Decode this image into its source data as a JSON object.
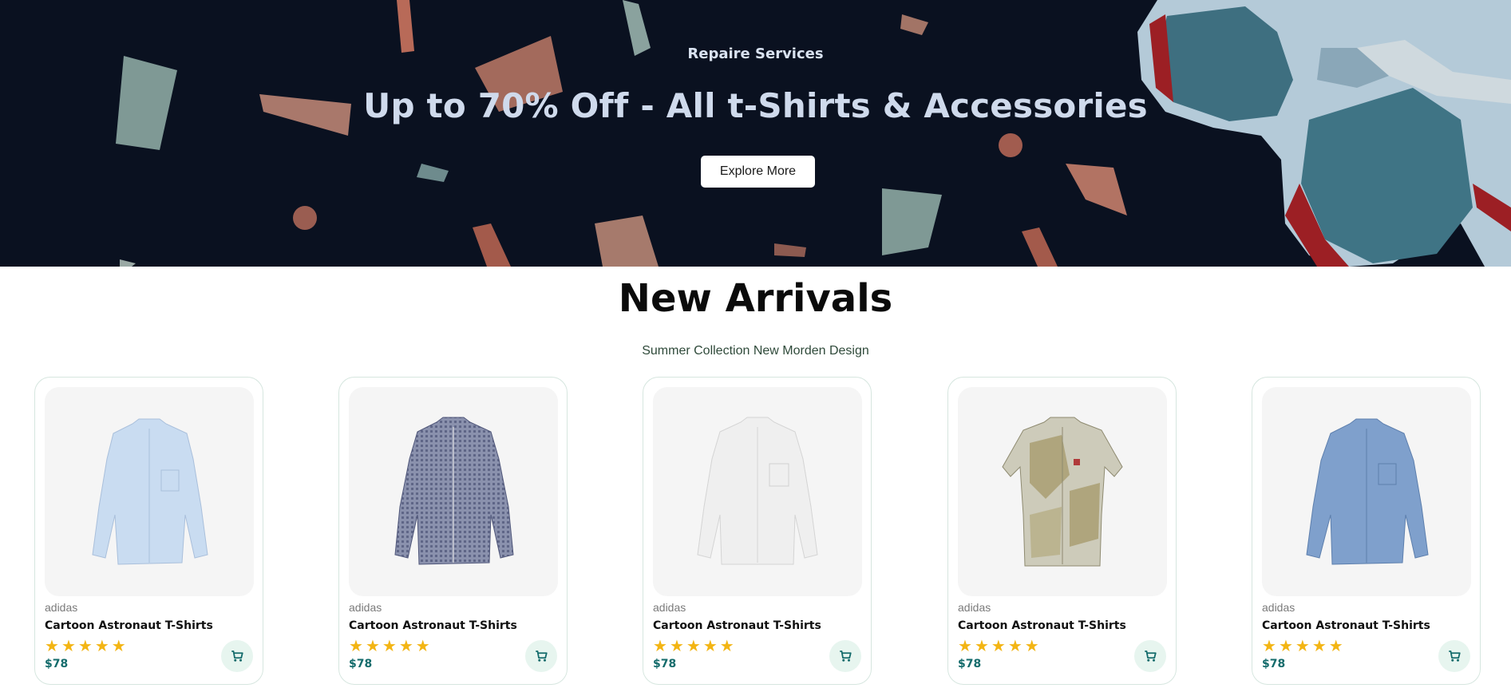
{
  "hero": {
    "subtitle": "Repaire Services",
    "title": "Up to 70% Off - All t-Shirts & Accessories",
    "button_label": "Explore More"
  },
  "section": {
    "title": "New Arrivals",
    "subtitle": "Summer Collection New Morden Design"
  },
  "colors": {
    "hero_bg": "#0a1120",
    "price": "#136b6b",
    "star": "#f3b514",
    "cart_bg": "#e7f5ef",
    "cart_icon": "#136b6b"
  },
  "products": [
    {
      "brand": "adidas",
      "name": "Cartoon Astronaut T-Shirts",
      "rating": 5,
      "price": "$78",
      "shirt_color": "#c9dcf1",
      "image_icon": "light-blue-shirt"
    },
    {
      "brand": "adidas",
      "name": "Cartoon Astronaut T-Shirts",
      "rating": 5,
      "price": "$78",
      "shirt_color": "#8088a6",
      "image_icon": "navy-gingham-shirt"
    },
    {
      "brand": "adidas",
      "name": "Cartoon Astronaut T-Shirts",
      "rating": 5,
      "price": "$78",
      "shirt_color": "#ececec",
      "image_icon": "white-shirt"
    },
    {
      "brand": "adidas",
      "name": "Cartoon Astronaut T-Shirts",
      "rating": 5,
      "price": "$78",
      "shirt_color": "#c8c6b4",
      "image_icon": "printed-short-sleeve-shirt"
    },
    {
      "brand": "adidas",
      "name": "Cartoon Astronaut T-Shirts",
      "rating": 5,
      "price": "$78",
      "shirt_color": "#7fa0cc",
      "image_icon": "denim-shirt"
    }
  ]
}
